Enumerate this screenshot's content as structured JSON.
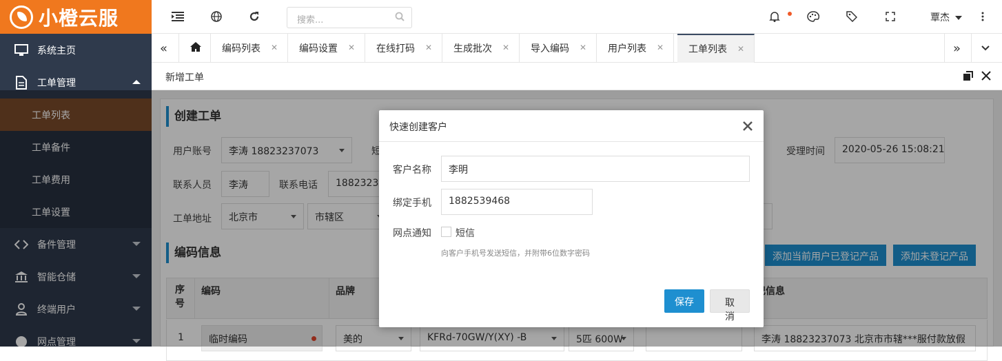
{
  "app": {
    "logo_text": "小橙云服",
    "brand_color": "#f0781e"
  },
  "sidebar": {
    "items": [
      {
        "label": "系统主页",
        "icon": "monitor-icon"
      },
      {
        "label": "工单管理",
        "icon": "document-icon",
        "expanded": true,
        "children": [
          {
            "label": "工单列表",
            "active": true
          },
          {
            "label": "工单备件"
          },
          {
            "label": "工单费用"
          },
          {
            "label": "工单设置"
          }
        ]
      },
      {
        "label": "备件管理",
        "icon": "diamond-arrows-icon"
      },
      {
        "label": "智能仓储",
        "icon": "bank-icon"
      },
      {
        "label": "终端用户",
        "icon": "user-icon"
      },
      {
        "label": "网点管理",
        "icon": "globe-icon"
      }
    ]
  },
  "topbar": {
    "search_placeholder": "搜索...",
    "user_name": "覃杰"
  },
  "tabs": [
    "编码列表",
    "编码设置",
    "在线打码",
    "生成批次",
    "导入编码",
    "用户列表",
    "工单列表"
  ],
  "active_tab": "工单列表",
  "breadcrumb": "新增工单",
  "form": {
    "section_title": "创建工单",
    "user_account_label": "用户账号",
    "user_account_value": "李涛 18823237073",
    "short_label": "短",
    "accept_time_label": "受理时间",
    "accept_time_value": "2020-05-26 15:08:21",
    "contact_label": "联系人员",
    "contact_value": "李涛",
    "phone_label": "联系电话",
    "phone_value": "18823237073",
    "address_label": "工单地址",
    "province_value": "北京市",
    "district_value": "市辖区"
  },
  "code_section": {
    "title": "编码信息",
    "add_registered_button": "添加当前用户已登记产品",
    "add_unregistered_button": "添加未登记产品",
    "columns": [
      "序号",
      "编码",
      "品牌",
      "记信息"
    ],
    "row": {
      "index": "1",
      "code": "临时编码",
      "brand": "美的",
      "model": "KFRd-70GW/Y(XY) -B",
      "power": "5匹 600W",
      "info": "李涛 18823237073 北京市市辖***服付款放假"
    }
  },
  "modal": {
    "title": "快速创建客户",
    "name_label": "客户名称",
    "name_value": "李明",
    "phone_label": "绑定手机",
    "phone_value": "1882539468",
    "notify_label": "网点通知",
    "sms_label": "短信",
    "sms_hint": "向客户手机号发送短信，并附带6位数字密码",
    "save_button": "保存",
    "cancel_button": "取消"
  }
}
